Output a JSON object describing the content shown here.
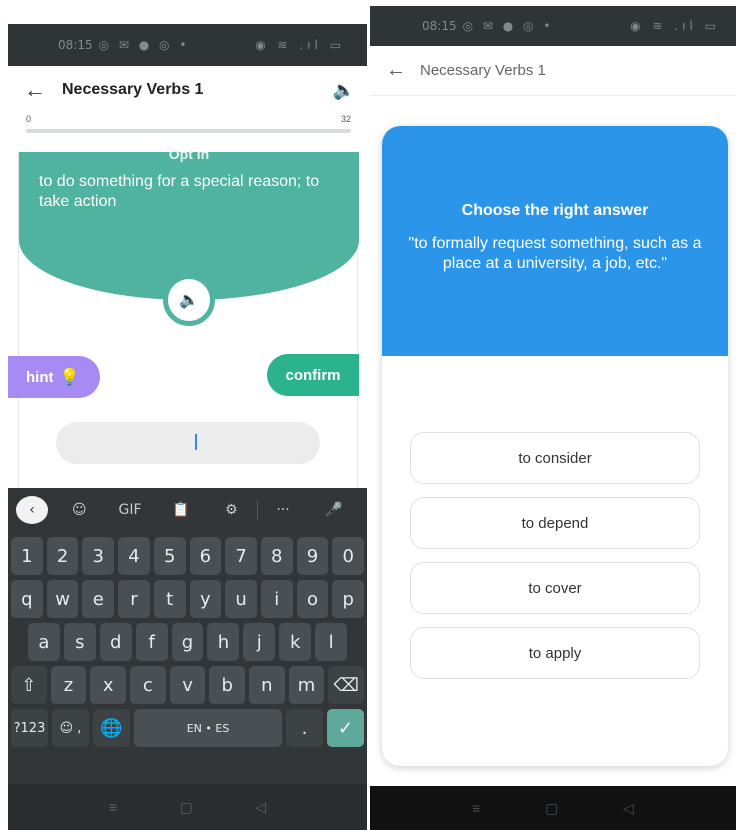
{
  "left": {
    "status": {
      "time": "08:15",
      "apps": "◎ ✉ ● ◎ •",
      "sys": "◉ ≋ .ıl ▭"
    },
    "appbar": {
      "back": "←",
      "title": "Necessary Verbs 1",
      "sound": "🔈"
    },
    "progress": {
      "min": "0",
      "max": "32",
      "value": 0
    },
    "card": {
      "cut_title": "Opt in",
      "definition": "to do something for a special reason; to take action",
      "speak_icon": "🔈"
    },
    "hint": {
      "label": "hint",
      "icon": "💡"
    },
    "confirm": {
      "label": "confirm"
    },
    "input": {
      "value": "",
      "placeholder": ""
    },
    "keyboard": {
      "toolbar": [
        "‹",
        "☺",
        "GIF",
        "📋",
        "⚙",
        "···",
        "🎤"
      ],
      "row_numbers": [
        "1",
        "2",
        "3",
        "4",
        "5",
        "6",
        "7",
        "8",
        "9",
        "0"
      ],
      "row1": [
        "q",
        "w",
        "e",
        "r",
        "t",
        "y",
        "u",
        "i",
        "o",
        "p"
      ],
      "row2": [
        "a",
        "s",
        "d",
        "f",
        "g",
        "h",
        "j",
        "k",
        "l"
      ],
      "row3": [
        "⇧",
        "z",
        "x",
        "c",
        "v",
        "b",
        "n",
        "m",
        "⌫"
      ],
      "row4": {
        "sym": "?123",
        "emoji": "☺ ,",
        "globe": "🌐",
        "space": "EN • ES",
        "dot": ".",
        "enter": "✓"
      }
    },
    "navbar": [
      "≡",
      "▢",
      "◁"
    ]
  },
  "right": {
    "status": {
      "time": "08:15",
      "apps": "◎ ✉ ● ◎ •",
      "sys": "◉ ≋ .ıl ▭"
    },
    "appbar": {
      "back": "←",
      "title": "Necessary Verbs 1"
    },
    "question": {
      "title": "Choose the right answer",
      "text": "\"to formally request something, such as a place at a university, a job, etc.\""
    },
    "options": [
      "to consider",
      "to depend",
      "to cover",
      "to apply"
    ],
    "navbar": [
      "≡",
      "▢",
      "◁"
    ]
  },
  "colors": {
    "teal": "#4fb3a0",
    "confirm": "#2bb38d",
    "hint": "#a78bf5",
    "blue": "#2b95ea"
  }
}
